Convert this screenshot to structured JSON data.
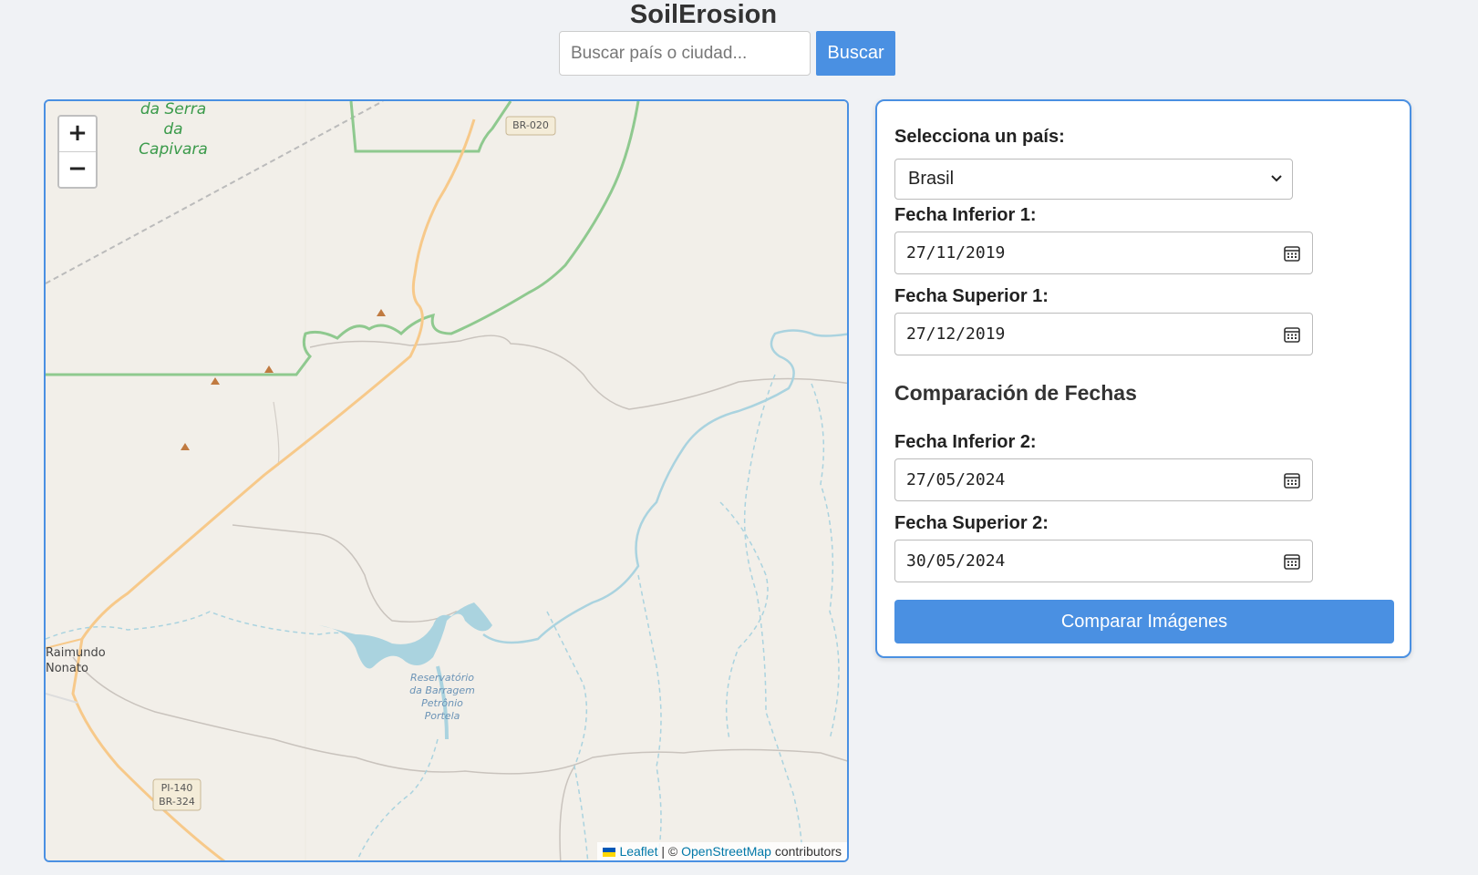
{
  "app": {
    "title": "SoilErosion"
  },
  "search": {
    "placeholder": "Buscar país o ciudad...",
    "value": "",
    "button_label": "Buscar"
  },
  "map": {
    "zoom_in_label": "+",
    "zoom_out_label": "−",
    "attribution": {
      "leaflet": "Leaflet",
      "separator": " | © ",
      "osm": "OpenStreetMap",
      "suffix": " contributors"
    },
    "labels": {
      "park_line1": "da Serra",
      "park_line2": "da Capivara",
      "town_line1": "Raimundo",
      "town_line2": "Nonato",
      "reservoir_line1": "Reservatório",
      "reservoir_line2": "da Barragem",
      "reservoir_line3": "Petrônio",
      "reservoir_line4": "Portela",
      "shield_br020": "BR-020",
      "shield_pi140": "PI-140",
      "shield_br324": "BR-324"
    },
    "colors": {
      "land": "#f2efe9",
      "water": "#aad3df",
      "road": "#f7c98a",
      "park_border": "#8fc98f"
    }
  },
  "form": {
    "country_label": "Selecciona un país:",
    "country_selected": "Brasil",
    "range1": {
      "lower_label": "Fecha Inferior 1:",
      "lower_value": "27/11/2019",
      "upper_label": "Fecha Superior 1:",
      "upper_value": "27/12/2019"
    },
    "comparison_title": "Comparación de Fechas",
    "range2": {
      "lower_label": "Fecha Inferior 2:",
      "lower_value": "27/05/2024",
      "upper_label": "Fecha Superior 2:",
      "upper_value": "30/05/2024"
    },
    "compare_button": "Comparar Imágenes"
  },
  "colors": {
    "accent": "#4a90e2",
    "background": "#f0f2f5"
  }
}
